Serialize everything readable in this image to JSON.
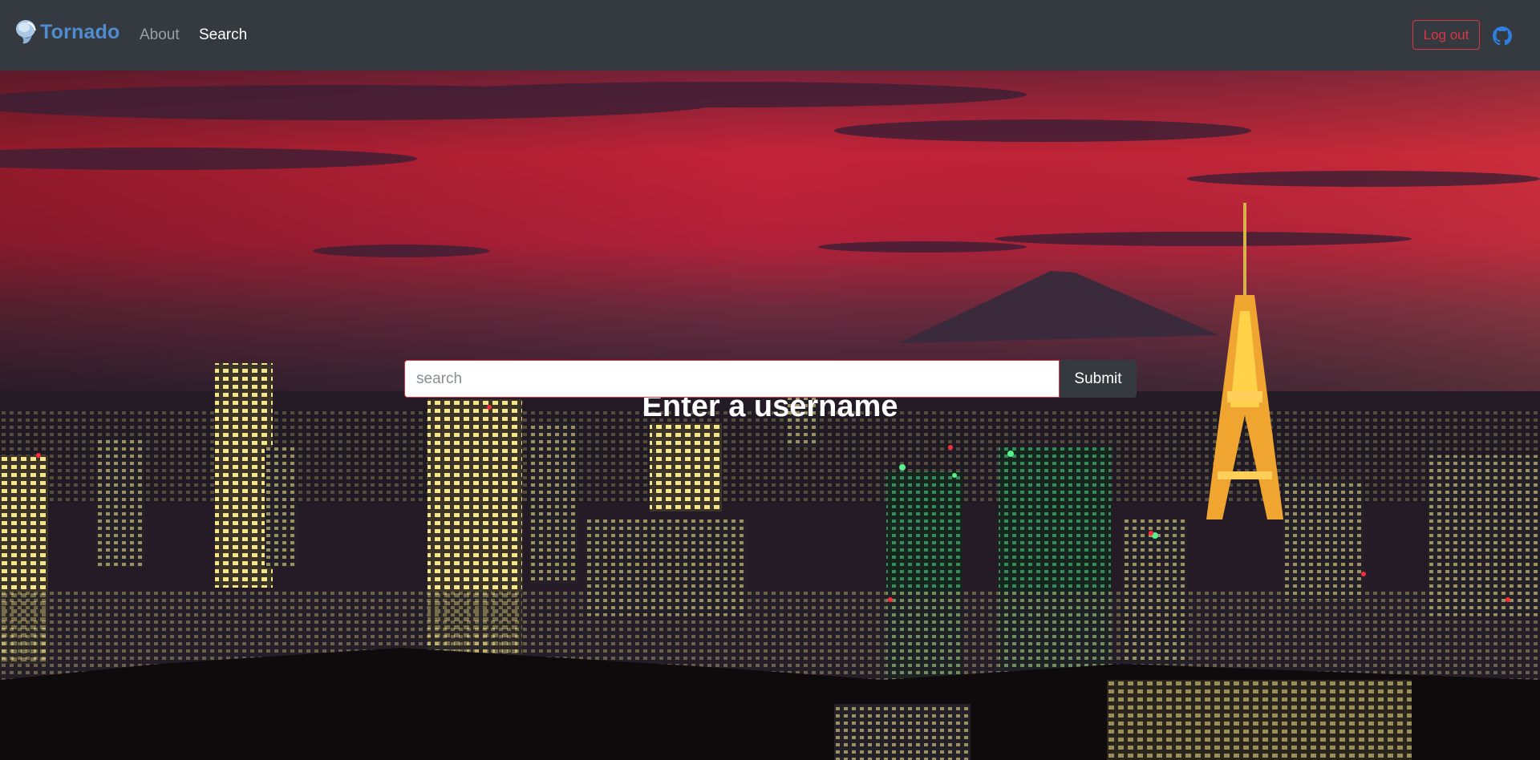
{
  "navbar": {
    "brand_text": "Tornado",
    "brand_icon": "tornado-logo-icon",
    "links": [
      {
        "label": "About"
      },
      {
        "label": "Search"
      }
    ],
    "logout_label": "Log out",
    "github_icon": "github-icon"
  },
  "hero": {
    "background": "tokyo-night-skyline-photo",
    "headline": "Enter a username",
    "search_placeholder": "search",
    "search_value": "",
    "submit_label": "Submit"
  },
  "colors": {
    "navbar_bg": "#343a40",
    "brand": "#4f8ccf",
    "danger": "#dc3545",
    "nav_muted": "#9aa0a6",
    "nav_active": "#ffffff",
    "github": "#2f7fe0"
  }
}
